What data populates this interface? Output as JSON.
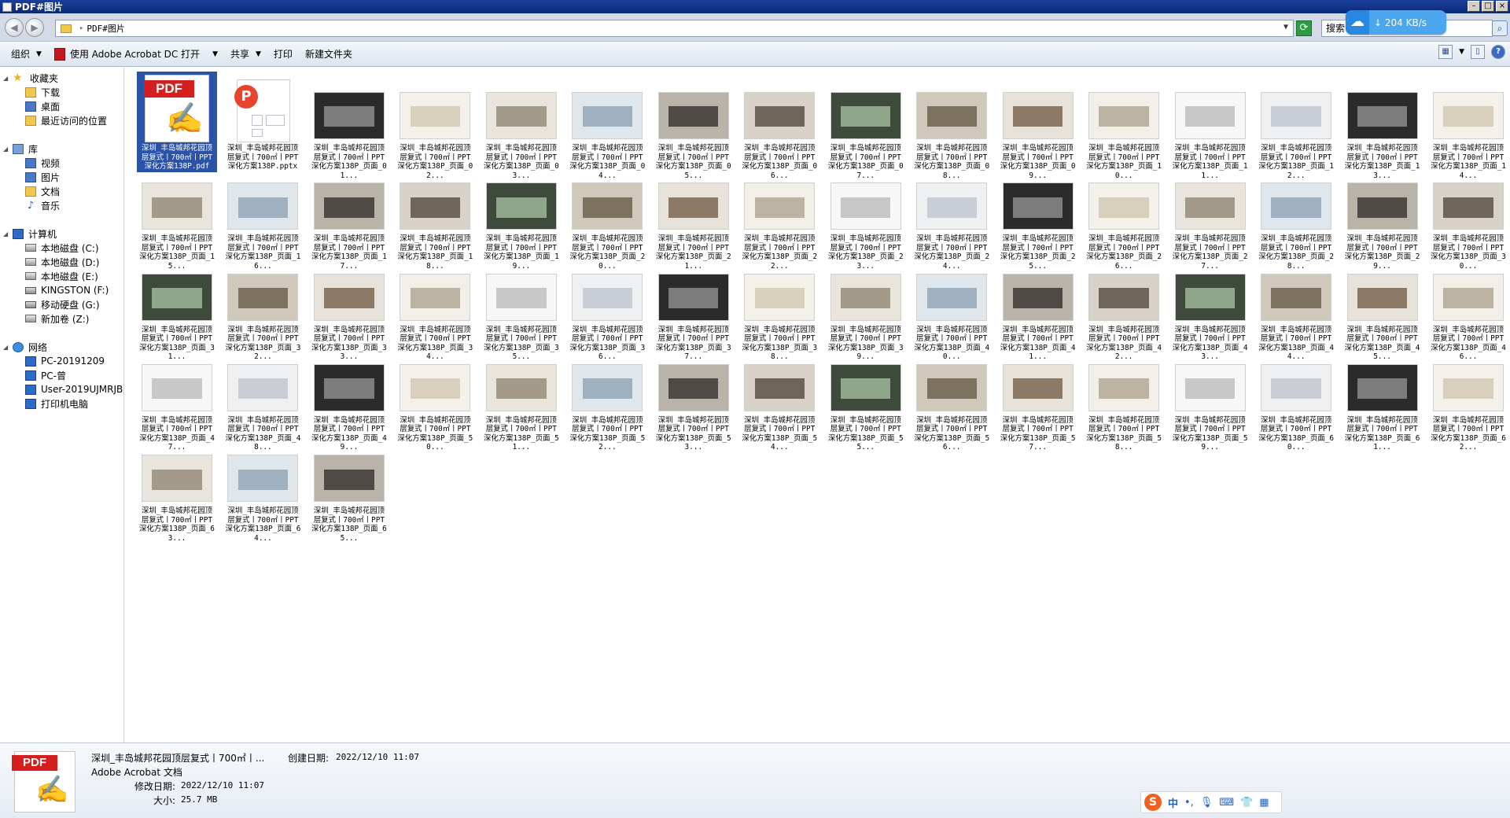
{
  "window": {
    "title": "PDF#图片"
  },
  "window_buttons": [
    "–",
    "□",
    "×"
  ],
  "address": {
    "path": "PDF#图片",
    "search_placeholder": "搜索"
  },
  "download_badge": {
    "speed": "204 KB/s"
  },
  "toolbar": {
    "organize": "组织",
    "open_with": "使用 Adobe Acrobat DC 打开",
    "share": "共享",
    "print": "打印",
    "new_folder": "新建文件夹"
  },
  "sidebar": {
    "favorites": {
      "label": "收藏夹",
      "items": [
        "下载",
        "桌面",
        "最近访问的位置"
      ]
    },
    "libraries": {
      "label": "库",
      "items": [
        "视频",
        "图片",
        "文档",
        "音乐"
      ]
    },
    "computer": {
      "label": "计算机",
      "items": [
        "本地磁盘 (C:)",
        "本地磁盘 (D:)",
        "本地磁盘 (E:)",
        "KINGSTON (F:)",
        "移动硬盘 (G:)",
        "新加卷 (Z:)"
      ]
    },
    "network": {
      "label": "网络",
      "items": [
        "PC-20191209",
        "PC-曾",
        "User-2019UJMRJB",
        "打印机电脑"
      ]
    }
  },
  "files": {
    "pdf_label": "深圳_丰岛城邦花园顶层复式丨700㎡丨PPT深化方案138P.pdf",
    "pptx_label": "深圳_丰岛城邦花园顶层复式丨700㎡丨PPT深化方案138P.pptx",
    "page_prefix": "深圳_丰岛城邦花园顶层复式丨700㎡丨PPT深化方案138P_页面_",
    "page_suffix": "...",
    "page_count": 65
  },
  "details": {
    "name": "深圳_丰岛城邦花园顶层复式丨700㎡丨...",
    "created_label": "创建日期:",
    "created_value": "2022/12/10 11:07",
    "type": "Adobe Acrobat 文档",
    "modified_label": "修改日期:",
    "modified_value": "2022/12/10 11:07",
    "size_label": "大小:",
    "size_value": "25.7 MB"
  },
  "ime": {
    "lang": "中"
  },
  "colors": {
    "selection": "#2a53a8",
    "pdf_red": "#d51f1f"
  }
}
